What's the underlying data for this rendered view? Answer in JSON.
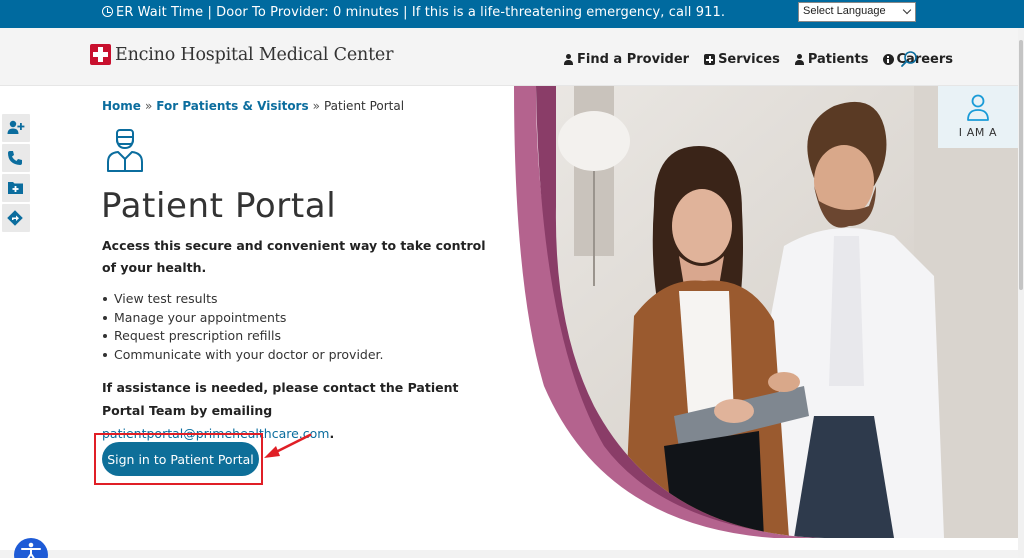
{
  "topbar": {
    "notice": "ER Wait Time | Door To Provider: 0 minutes | If this is a life-threatening emergency, call 911.",
    "language_select": "Select Language"
  },
  "header": {
    "logo_text": "Encino Hospital Medical Center",
    "nav": [
      {
        "label": "Find a Provider",
        "icon": "doctor-icon"
      },
      {
        "label": "Services",
        "icon": "plus-square-icon"
      },
      {
        "label": "Patients",
        "icon": "user-icon"
      },
      {
        "label": "Careers",
        "icon": "info-circle-icon"
      }
    ]
  },
  "breadcrumb": {
    "home": "Home",
    "sep1": "»",
    "section": "For Patients & Visitors",
    "sep2": "»",
    "current": "Patient Portal"
  },
  "main": {
    "title": "Patient Portal",
    "intro": "Access this secure and convenient way to take control of your health.",
    "bullets": [
      "View test results",
      "Manage your appointments",
      "Request prescription refills",
      "Communicate with your doctor or provider."
    ],
    "assist_text": "If assistance is needed, please contact the Patient Portal Team by emailing",
    "assist_email": "patientportal@primehealthcare.com",
    "assist_end": ".",
    "signin_label": "Sign in to Patient Portal"
  },
  "iam": {
    "label": "I AM A"
  },
  "colors": {
    "topbar": "#006a9f",
    "link": "#0b6d9e",
    "button": "#0e6f99",
    "highlight": "#e01f26",
    "hero_curve_outer": "#b4638e",
    "hero_curve_inner": "#8a3d68"
  }
}
